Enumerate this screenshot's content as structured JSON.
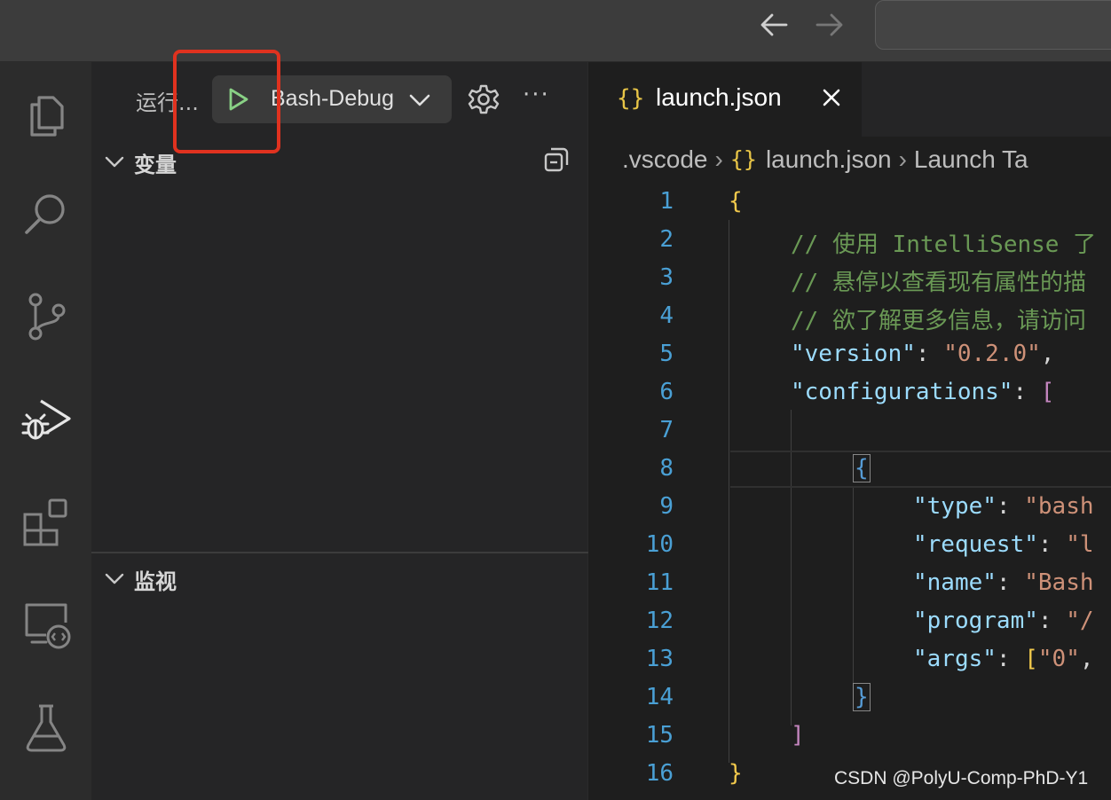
{
  "titlebar": {
    "back_icon": "arrow-left-icon",
    "forward_icon": "arrow-right-icon"
  },
  "activity_bar": {
    "items": [
      {
        "name": "explorer",
        "icon": "files-icon"
      },
      {
        "name": "search",
        "icon": "search-icon"
      },
      {
        "name": "source-control",
        "icon": "source-control-icon"
      },
      {
        "name": "run-and-debug",
        "icon": "debug-icon",
        "active": true
      },
      {
        "name": "extensions",
        "icon": "extensions-icon"
      },
      {
        "name": "remote-explorer",
        "icon": "remote-explorer-icon"
      },
      {
        "name": "testing",
        "icon": "beaker-icon"
      }
    ]
  },
  "sidebar": {
    "run_label": "运行...",
    "config_name": "Bash-Debug",
    "sections": {
      "variables": "变量",
      "watch": "监视"
    }
  },
  "editor": {
    "tab": {
      "name": "launch.json",
      "braces": "{}"
    },
    "breadcrumb": {
      "folder": ".vscode",
      "file": "launch.json",
      "symbol": "Launch Ta"
    },
    "line_numbers": [
      "1",
      "2",
      "3",
      "4",
      "5",
      "6",
      "7",
      "8",
      "9",
      "10",
      "11",
      "12",
      "13",
      "14",
      "15",
      "16"
    ],
    "lines": {
      "l1": "{",
      "l2": "// 使用 IntelliSense 了",
      "l3": "// 悬停以查看现有属性的描",
      "l4": "// 欲了解更多信息，请访问",
      "l5_key": "\"version\"",
      "l5_colon": ": ",
      "l5_val": "\"0.2.0\"",
      "l5_comma": ",",
      "l6_key": "\"configurations\"",
      "l6_colon": ": ",
      "l6_bracket": "[",
      "l8": "{",
      "l9_key": "\"type\"",
      "l9_colon": ": ",
      "l9_val": "\"bash",
      "l10_key": "\"request\"",
      "l10_colon": ": ",
      "l10_val": "\"l",
      "l11_key": "\"name\"",
      "l11_colon": ": ",
      "l11_val": "\"Bash",
      "l12_key": "\"program\"",
      "l12_colon": ": ",
      "l12_val": "\"/",
      "l13_key": "\"args\"",
      "l13_colon": ": ",
      "l13_bracket": "[",
      "l13_val": "\"0\"",
      "l13_comma": ",",
      "l14": "}",
      "l15": "]",
      "l16": "}"
    }
  },
  "watermark": "CSDN @PolyU-Comp-PhD-Y1",
  "colors": {
    "highlight_box": "#e0321f",
    "play_green": "#89d185",
    "line_number": "#4aa0d5"
  }
}
